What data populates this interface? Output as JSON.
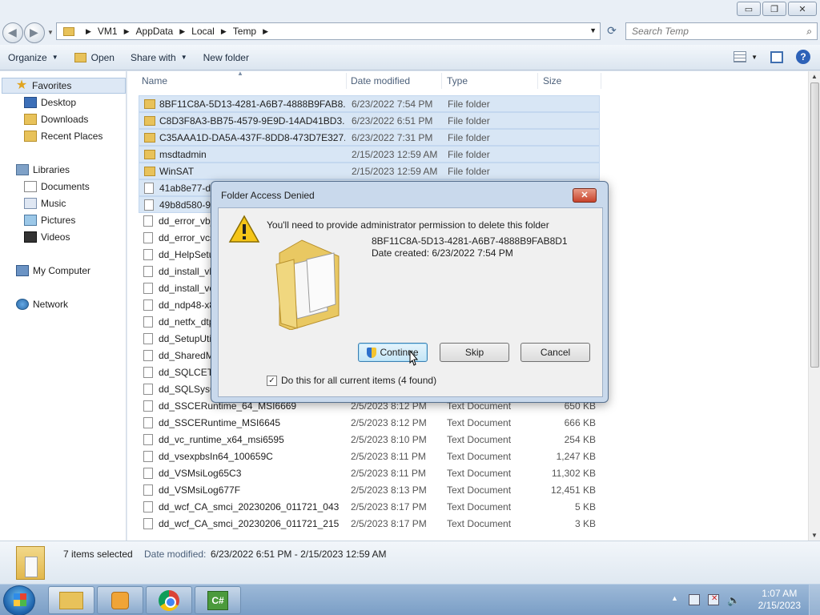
{
  "window": {
    "minimize": "▭",
    "maximize": "❐",
    "close": "✕"
  },
  "address": {
    "breadcrumbs": [
      "VM1",
      "AppData",
      "Local",
      "Temp"
    ],
    "search_placeholder": "Search Temp"
  },
  "toolbar": {
    "organize": "Organize",
    "open": "Open",
    "share_with": "Share with",
    "new_folder": "New folder"
  },
  "sidebar": {
    "favorites": "Favorites",
    "desktop": "Desktop",
    "downloads": "Downloads",
    "recent_places": "Recent Places",
    "libraries": "Libraries",
    "documents": "Documents",
    "music": "Music",
    "pictures": "Pictures",
    "videos": "Videos",
    "my_computer": "My Computer",
    "network": "Network"
  },
  "columns": {
    "name": "Name",
    "date_modified": "Date modified",
    "type": "Type",
    "size": "Size"
  },
  "files": [
    {
      "name": "8BF11C8A-5D13-4281-A6B7-4888B9FAB8...",
      "date": "6/23/2022 7:54 PM",
      "type": "File folder",
      "size": "",
      "kind": "folder",
      "selected": true
    },
    {
      "name": "C8D3F8A3-BB75-4579-9E9D-14AD41BD3...",
      "date": "6/23/2022 6:51 PM",
      "type": "File folder",
      "size": "",
      "kind": "folder",
      "selected": true
    },
    {
      "name": "C35AAA1D-DA5A-437F-8DD8-473D7E327...",
      "date": "6/23/2022 7:31 PM",
      "type": "File folder",
      "size": "",
      "kind": "folder",
      "selected": true
    },
    {
      "name": "msdtadmin",
      "date": "2/15/2023 12:59 AM",
      "type": "File folder",
      "size": "",
      "kind": "folder",
      "selected": true
    },
    {
      "name": "WinSAT",
      "date": "2/15/2023 12:59 AM",
      "type": "File folder",
      "size": "",
      "kind": "folder",
      "selected": true
    },
    {
      "name": "41ab8e77-d4",
      "date": "",
      "type": "",
      "size": "",
      "kind": "file",
      "selected": true
    },
    {
      "name": "49b8d580-92",
      "date": "",
      "type": "",
      "size": "",
      "kind": "file",
      "selected": true
    },
    {
      "name": "dd_error_vb_",
      "date": "",
      "type": "",
      "size": "",
      "kind": "file",
      "selected": false
    },
    {
      "name": "dd_error_vcs",
      "date": "",
      "type": "",
      "size": "",
      "kind": "file",
      "selected": false
    },
    {
      "name": "dd_HelpSetu",
      "date": "",
      "type": "",
      "size": "",
      "kind": "file",
      "selected": false
    },
    {
      "name": "dd_install_vb",
      "date": "",
      "type": "",
      "size": "",
      "kind": "file",
      "selected": false
    },
    {
      "name": "dd_install_vc",
      "date": "",
      "type": "",
      "size": "",
      "kind": "file",
      "selected": false
    },
    {
      "name": "dd_ndp48-x8",
      "date": "",
      "type": "",
      "size": "",
      "kind": "file",
      "selected": false
    },
    {
      "name": "dd_netfx_dtp",
      "date": "",
      "type": "",
      "size": "",
      "kind": "file",
      "selected": false
    },
    {
      "name": "dd_SetupUti",
      "date": "",
      "type": "",
      "size": "",
      "kind": "file",
      "selected": false
    },
    {
      "name": "dd_SharedM",
      "date": "",
      "type": "",
      "size": "",
      "kind": "file",
      "selected": false
    },
    {
      "name": "dd_SQLCETc",
      "date": "",
      "type": "",
      "size": "",
      "kind": "file",
      "selected": false
    },
    {
      "name": "dd_SQLSysC",
      "date": "",
      "type": "",
      "size": "",
      "kind": "file",
      "selected": false
    },
    {
      "name": "dd_SSCERuntime_64_MSI6669",
      "date": "2/5/2023 8:12 PM",
      "type": "Text Document",
      "size": "650 KB",
      "kind": "file",
      "selected": false
    },
    {
      "name": "dd_SSCERuntime_MSI6645",
      "date": "2/5/2023 8:12 PM",
      "type": "Text Document",
      "size": "666 KB",
      "kind": "file",
      "selected": false
    },
    {
      "name": "dd_vc_runtime_x64_msi6595",
      "date": "2/5/2023 8:10 PM",
      "type": "Text Document",
      "size": "254 KB",
      "kind": "file",
      "selected": false
    },
    {
      "name": "dd_vsexpbsIn64_100659C",
      "date": "2/5/2023 8:11 PM",
      "type": "Text Document",
      "size": "1,247 KB",
      "kind": "file",
      "selected": false
    },
    {
      "name": "dd_VSMsiLog65C3",
      "date": "2/5/2023 8:11 PM",
      "type": "Text Document",
      "size": "11,302 KB",
      "kind": "file",
      "selected": false
    },
    {
      "name": "dd_VSMsiLog677F",
      "date": "2/5/2023 8:13 PM",
      "type": "Text Document",
      "size": "12,451 KB",
      "kind": "file",
      "selected": false
    },
    {
      "name": "dd_wcf_CA_smci_20230206_011721_043",
      "date": "2/5/2023 8:17 PM",
      "type": "Text Document",
      "size": "5 KB",
      "kind": "file",
      "selected": false
    },
    {
      "name": "dd_wcf_CA_smci_20230206_011721_215",
      "date": "2/5/2023 8:17 PM",
      "type": "Text Document",
      "size": "3 KB",
      "kind": "file",
      "selected": false
    }
  ],
  "details": {
    "count": "7 items selected",
    "date_label": "Date modified:",
    "date_value": "6/23/2022 6:51 PM - 2/15/2023 12:59 AM"
  },
  "dialog": {
    "title": "Folder Access Denied",
    "close": "✕",
    "message": "You'll need to provide administrator permission to delete this folder",
    "folder_name": "8BF11C8A-5D13-4281-A6B7-4888B9FAB8D1",
    "date_created": "Date created: 6/23/2022 7:54 PM",
    "continue": "Continue",
    "skip": "Skip",
    "cancel": "Cancel",
    "checkbox_label": "Do this for all current items (4 found)",
    "checkbox_checked": true
  },
  "taskbar": {
    "time": "1:07 AM",
    "date": "2/15/2023",
    "cs_label": "C#"
  },
  "colors": {
    "selection": "#d8e6f5",
    "dialog_frame": "#c9d9ec",
    "taskbar": "#7a9ec6"
  }
}
